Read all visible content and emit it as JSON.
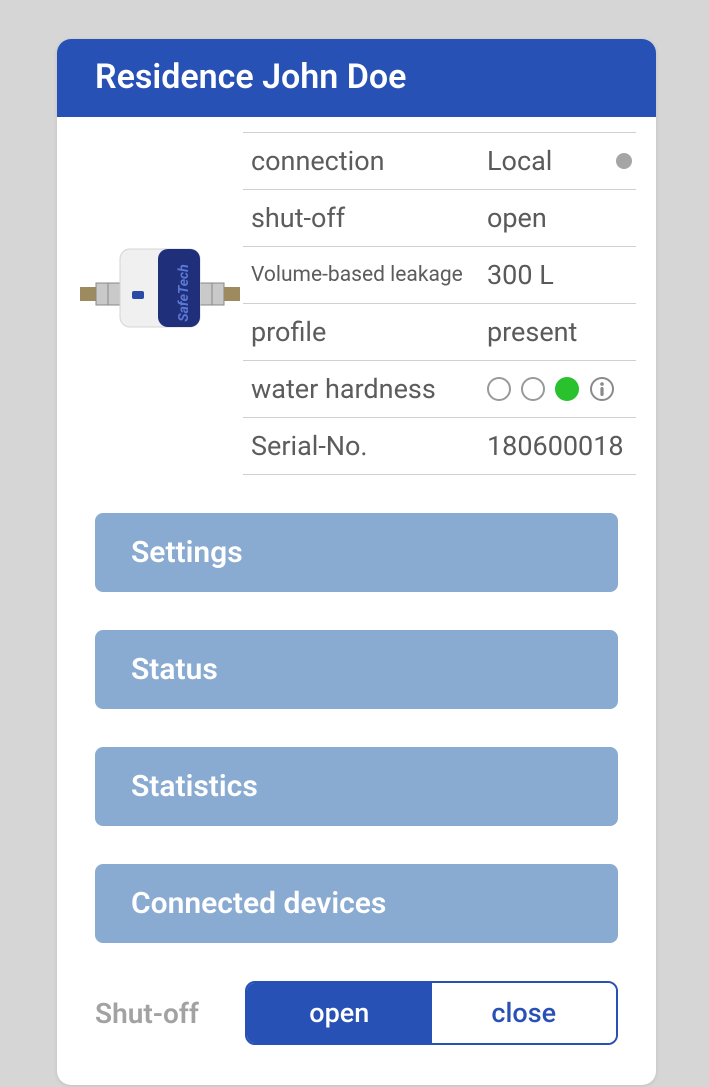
{
  "header": {
    "title": "Residence John Doe"
  },
  "props": {
    "connection": {
      "label": "connection",
      "value": "Local"
    },
    "shutoff": {
      "label": "shut-off",
      "value": "open"
    },
    "leakage": {
      "label": "Volume-based leakage",
      "value": "300 L"
    },
    "profile": {
      "label": "profile",
      "value": "present"
    },
    "hardness": {
      "label": "water hardness"
    },
    "serial": {
      "label": "Serial-No.",
      "value": "180600018"
    }
  },
  "menu": {
    "settings": "Settings",
    "status": "Status",
    "statistics": "Statistics",
    "devices": "Connected devices"
  },
  "shutoff_control": {
    "label": "Shut-off",
    "open": "open",
    "close": "close"
  }
}
